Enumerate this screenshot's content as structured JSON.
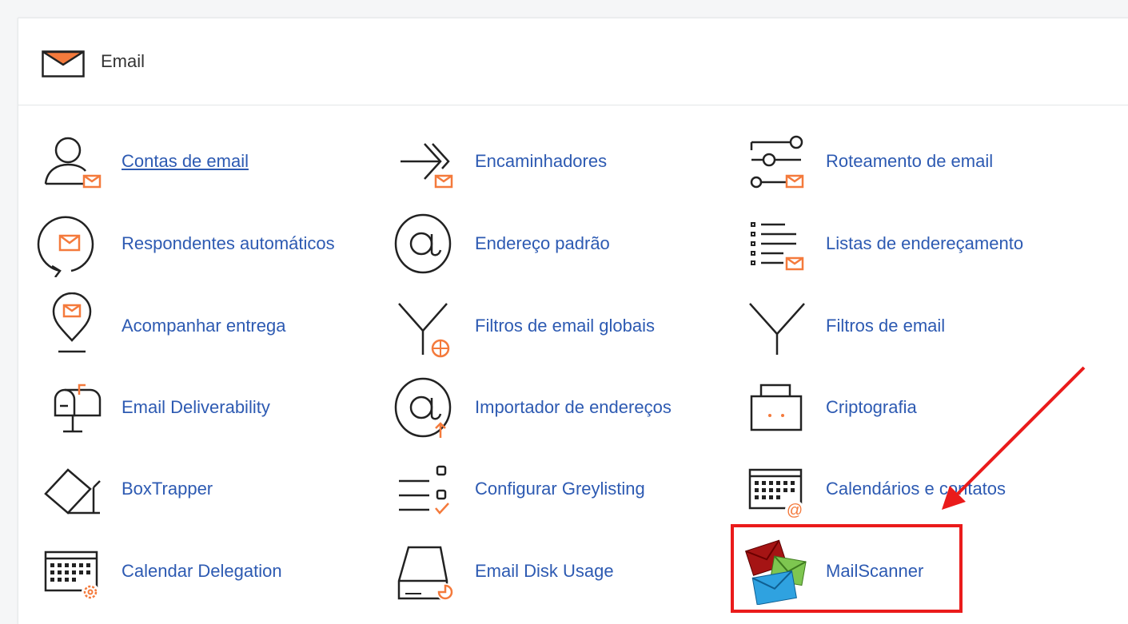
{
  "section": {
    "title": "Email",
    "icon": "envelope-icon"
  },
  "items": [
    {
      "label": "Contas de email",
      "icon": "email-accounts-icon",
      "underline": true
    },
    {
      "label": "Encaminhadores",
      "icon": "forwarders-icon"
    },
    {
      "label": "Roteamento de email",
      "icon": "email-routing-icon"
    },
    {
      "label": "Respondentes automáticos",
      "icon": "autoresponders-icon"
    },
    {
      "label": "Endereço padrão",
      "icon": "default-address-icon"
    },
    {
      "label": "Listas de endereçamento",
      "icon": "mailing-lists-icon"
    },
    {
      "label": "Acompanhar entrega",
      "icon": "track-delivery-icon"
    },
    {
      "label": "Filtros de email globais",
      "icon": "global-email-filters-icon"
    },
    {
      "label": "Filtros de email",
      "icon": "email-filters-icon"
    },
    {
      "label": "Email Deliverability",
      "icon": "mailbox-icon"
    },
    {
      "label": "Importador de endereços",
      "icon": "address-importer-icon"
    },
    {
      "label": "Criptografia",
      "icon": "encryption-icon"
    },
    {
      "label": "BoxTrapper",
      "icon": "boxtrapper-icon"
    },
    {
      "label": "Configurar Greylisting",
      "icon": "greylisting-icon"
    },
    {
      "label": "Calendários e contatos",
      "icon": "calendars-contacts-icon"
    },
    {
      "label": "Calendar Delegation",
      "icon": "calendar-delegation-icon"
    },
    {
      "label": "Email Disk Usage",
      "icon": "disk-usage-icon"
    },
    {
      "label": "MailScanner",
      "icon": "mailscanner-icon"
    }
  ],
  "colors": {
    "accent": "#f47a3c",
    "link": "#2d5ab2",
    "annotation": "#ea1b1b"
  }
}
